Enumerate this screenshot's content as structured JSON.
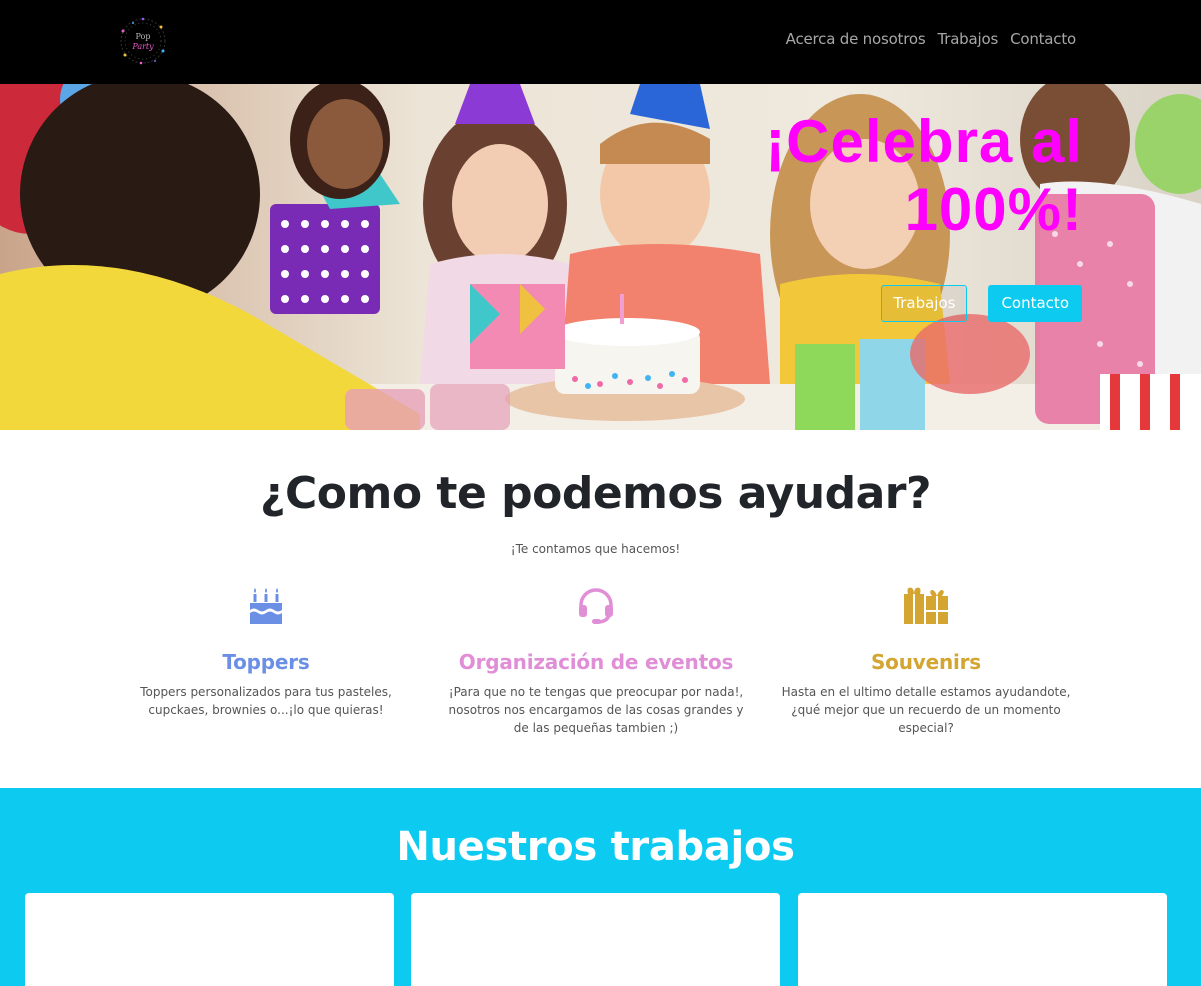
{
  "navbar": {
    "logo_icon": "party-logo",
    "links": [
      "Acerca de nosotros",
      "Trabajos",
      "Contacto"
    ]
  },
  "hero": {
    "title": "¡Celebra al 100%!",
    "buttons": [
      "Trabajos",
      "Contacto"
    ],
    "title_color": "#ff00ff",
    "accent_color": "#0dcaf0"
  },
  "help": {
    "title": "¿Como te podemos ayudar?",
    "subtitle": "¡Te contamos que hacemos!",
    "services": [
      {
        "icon": "birthday-cake-icon",
        "title": "Toppers",
        "description": "Toppers personalizados para tus pasteles, cupckaes, brownies o...¡lo que quieras!",
        "color": "#6c8fe6"
      },
      {
        "icon": "headset-icon",
        "title": "Organización de eventos",
        "description": "¡Para que no te tengas que preocupar por nada!, nosotros nos encargamos de las cosas grandes y de las pequeñas tambien ;)",
        "color": "#e08ed6"
      },
      {
        "icon": "gifts-icon",
        "title": "Souvenirs",
        "description": "Hasta en el ultimo detalle estamos ayudandote, ¿qué mejor que un recuerdo de un momento especial?",
        "color": "#d4a530"
      }
    ]
  },
  "works": {
    "title": "Nuestros trabajos",
    "background_color": "#0dcaf0"
  }
}
